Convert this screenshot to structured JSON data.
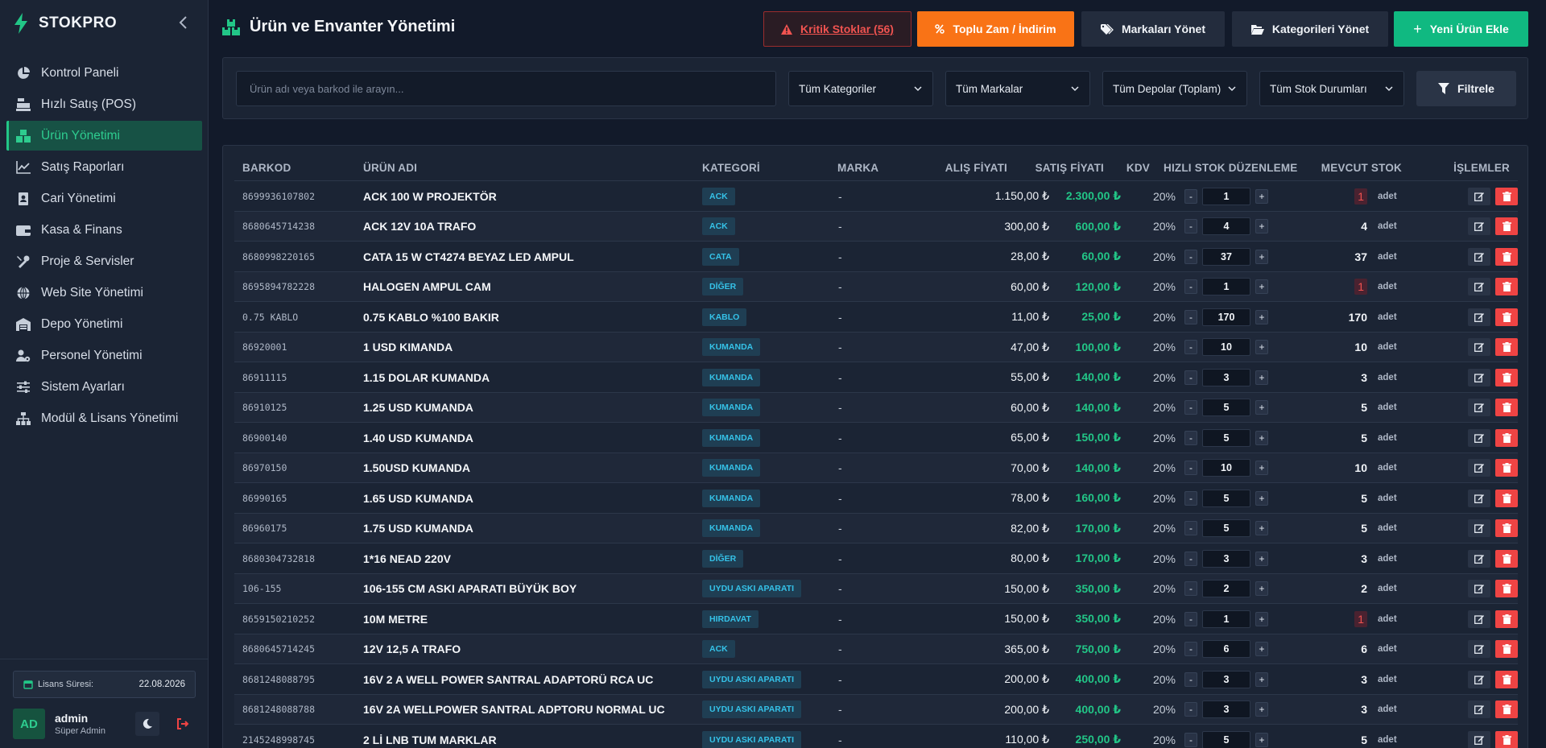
{
  "app": {
    "name": "STOKPRO"
  },
  "sidebar": {
    "items": [
      {
        "label": "Kontrol Paneli",
        "icon": "chart-pie-icon",
        "active": false
      },
      {
        "label": "Hızlı Satış (POS)",
        "icon": "cash-register-icon",
        "active": false
      },
      {
        "label": "Ürün Yönetimi",
        "icon": "boxes-icon",
        "active": true
      },
      {
        "label": "Satış Raporları",
        "icon": "chart-line-icon",
        "active": false
      },
      {
        "label": "Cari Yönetimi",
        "icon": "address-book-icon",
        "active": false
      },
      {
        "label": "Kasa & Finans",
        "icon": "wallet-icon",
        "active": false
      },
      {
        "label": "Proje & Servisler",
        "icon": "tools-icon",
        "active": false
      },
      {
        "label": "Web Site Yönetimi",
        "icon": "globe-icon",
        "active": false
      },
      {
        "label": "Depo Yönetimi",
        "icon": "warehouse-icon",
        "active": false
      },
      {
        "label": "Personel Yönetimi",
        "icon": "users-gear-icon",
        "active": false
      },
      {
        "label": "Sistem Ayarları",
        "icon": "sliders-icon",
        "active": false
      },
      {
        "label": "Modül & Lisans Yönetimi",
        "icon": "sitemap-icon",
        "active": false
      }
    ],
    "license": {
      "label": "Lisans Süresi:",
      "value": "22.08.2026"
    },
    "user": {
      "initials": "AD",
      "name": "admin",
      "role": "Süper Admin"
    }
  },
  "header": {
    "title": "Ürün ve Envanter Yönetimi",
    "critical_label": "Kritik Stoklar (56)",
    "bulk_label": "Toplu Zam / İndirim",
    "brands_label": "Markaları Yönet",
    "categories_label": "Kategorileri Yönet",
    "new_label": "Yeni Ürün Ekle"
  },
  "filters": {
    "search_placeholder": "Ürün adı veya barkod ile arayın...",
    "category": "Tüm Kategoriler",
    "brand": "Tüm Markalar",
    "warehouse": "Tüm Depolar (Toplam)",
    "stock_status": "Tüm Stok Durumları",
    "filter_label": "Filtrele"
  },
  "table": {
    "headers": {
      "barcode": "BARKOD",
      "name": "ÜRÜN ADI",
      "category": "KATEGORİ",
      "brand": "MARKA",
      "buy": "ALIŞ FİYATI",
      "sell": "SATIŞ FİYATI",
      "kdv": "KDV",
      "quick": "HIZLI STOK DÜZENLEME",
      "stock": "MEVCUT STOK",
      "actions": "İŞLEMLER"
    },
    "unit": "adet",
    "rows": [
      {
        "barcode": "8699936107802",
        "name": "ACK 100 W PROJEKTÖR",
        "category": "ACK",
        "brand": "-",
        "buy": "1.150,00 ₺",
        "sell": "2.300,00 ₺",
        "kdv": "20%",
        "qty": "1",
        "stock": "1",
        "low": true
      },
      {
        "barcode": "8680645714238",
        "name": "ACK 12V 10A TRAFO",
        "category": "ACK",
        "brand": "-",
        "buy": "300,00 ₺",
        "sell": "600,00 ₺",
        "kdv": "20%",
        "qty": "4",
        "stock": "4",
        "low": false
      },
      {
        "barcode": "8680998220165",
        "name": "CATA 15 W CT4274 BEYAZ LED AMPUL",
        "category": "CATA",
        "brand": "-",
        "buy": "28,00 ₺",
        "sell": "60,00 ₺",
        "kdv": "20%",
        "qty": "37",
        "stock": "37",
        "low": false
      },
      {
        "barcode": "8695894782228",
        "name": "HALOGEN AMPUL CAM",
        "category": "DİĞER",
        "brand": "-",
        "buy": "60,00 ₺",
        "sell": "120,00 ₺",
        "kdv": "20%",
        "qty": "1",
        "stock": "1",
        "low": true
      },
      {
        "barcode": "0.75 KABLO",
        "name": "0.75 KABLO %100 BAKIR",
        "category": "KABLO",
        "brand": "-",
        "buy": "11,00 ₺",
        "sell": "25,00 ₺",
        "kdv": "20%",
        "qty": "170",
        "stock": "170",
        "low": false
      },
      {
        "barcode": "86920001",
        "name": "1 USD KIMANDA",
        "category": "KUMANDA",
        "brand": "-",
        "buy": "47,00 ₺",
        "sell": "100,00 ₺",
        "kdv": "20%",
        "qty": "10",
        "stock": "10",
        "low": false
      },
      {
        "barcode": "86911115",
        "name": "1.15 DOLAR KUMANDA",
        "category": "KUMANDA",
        "brand": "-",
        "buy": "55,00 ₺",
        "sell": "140,00 ₺",
        "kdv": "20%",
        "qty": "3",
        "stock": "3",
        "low": false
      },
      {
        "barcode": "86910125",
        "name": "1.25 USD KUMANDA",
        "category": "KUMANDA",
        "brand": "-",
        "buy": "60,00 ₺",
        "sell": "140,00 ₺",
        "kdv": "20%",
        "qty": "5",
        "stock": "5",
        "low": false
      },
      {
        "barcode": "86900140",
        "name": "1.40 USD KUMANDA",
        "category": "KUMANDA",
        "brand": "-",
        "buy": "65,00 ₺",
        "sell": "150,00 ₺",
        "kdv": "20%",
        "qty": "5",
        "stock": "5",
        "low": false
      },
      {
        "barcode": "86970150",
        "name": "1.50USD KUMANDA",
        "category": "KUMANDA",
        "brand": "-",
        "buy": "70,00 ₺",
        "sell": "140,00 ₺",
        "kdv": "20%",
        "qty": "10",
        "stock": "10",
        "low": false
      },
      {
        "barcode": "86990165",
        "name": "1.65 USD KUMANDA",
        "category": "KUMANDA",
        "brand": "-",
        "buy": "78,00 ₺",
        "sell": "160,00 ₺",
        "kdv": "20%",
        "qty": "5",
        "stock": "5",
        "low": false
      },
      {
        "barcode": "86960175",
        "name": "1.75 USD KUMANDA",
        "category": "KUMANDA",
        "brand": "-",
        "buy": "82,00 ₺",
        "sell": "170,00 ₺",
        "kdv": "20%",
        "qty": "5",
        "stock": "5",
        "low": false
      },
      {
        "barcode": "8680304732818",
        "name": "1*16 NEAD 220V",
        "category": "DİĞER",
        "brand": "-",
        "buy": "80,00 ₺",
        "sell": "170,00 ₺",
        "kdv": "20%",
        "qty": "3",
        "stock": "3",
        "low": false
      },
      {
        "barcode": "106-155",
        "name": "106-155 CM ASKI APARATI BÜYÜK BOY",
        "category": "UYDU ASKI APARATI",
        "brand": "-",
        "buy": "150,00 ₺",
        "sell": "350,00 ₺",
        "kdv": "20%",
        "qty": "2",
        "stock": "2",
        "low": false
      },
      {
        "barcode": "8659150210252",
        "name": "10M METRE",
        "category": "HIRDAVAT",
        "brand": "-",
        "buy": "150,00 ₺",
        "sell": "350,00 ₺",
        "kdv": "20%",
        "qty": "1",
        "stock": "1",
        "low": true
      },
      {
        "barcode": "8680645714245",
        "name": "12V 12,5 A TRAFO",
        "category": "ACK",
        "brand": "-",
        "buy": "365,00 ₺",
        "sell": "750,00 ₺",
        "kdv": "20%",
        "qty": "6",
        "stock": "6",
        "low": false
      },
      {
        "barcode": "8681248088795",
        "name": "16V 2 A WELL POWER SANTRAL ADAPTORÜ RCA UC",
        "category": "UYDU ASKI APARATI",
        "brand": "-",
        "buy": "200,00 ₺",
        "sell": "400,00 ₺",
        "kdv": "20%",
        "qty": "3",
        "stock": "3",
        "low": false
      },
      {
        "barcode": "8681248088788",
        "name": "16V 2A WELLPOWER SANTRAL ADPTORU NORMAL UC",
        "category": "UYDU ASKI APARATI",
        "brand": "-",
        "buy": "200,00 ₺",
        "sell": "400,00 ₺",
        "kdv": "20%",
        "qty": "3",
        "stock": "3",
        "low": false
      },
      {
        "barcode": "2145248998745",
        "name": "2 Lİ LNB TUM MARKLAR",
        "category": "UYDU ASKI APARATI",
        "brand": "-",
        "buy": "110,00 ₺",
        "sell": "250,00 ₺",
        "kdv": "20%",
        "qty": "5",
        "stock": "5",
        "low": false
      }
    ]
  }
}
